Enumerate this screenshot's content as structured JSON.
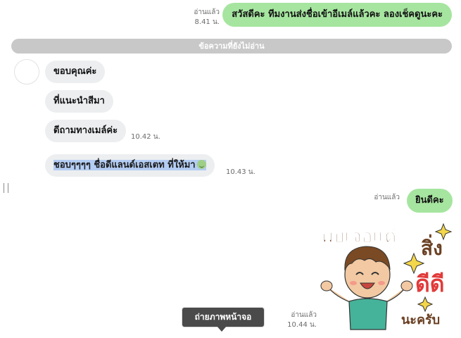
{
  "messages": {
    "m1": {
      "text": "สวัสดีคะ ทีมงานส่งชื่อเข้าอีเมล์แล้วคะ ลองเช็คดูนะคะ",
      "read": "อ่านแล้ว",
      "time": "8.41 น."
    },
    "unread_divider": "ข้อความที่ยังไม่อ่าน",
    "m2": {
      "text": "ขอบคุณค่ะ"
    },
    "m3": {
      "text": "ที่แนะนำสีมา"
    },
    "m4": {
      "text": "ดีถามทางเมล์ค่ะ",
      "time": "10.42 น."
    },
    "m5": {
      "text": "ชอบๆๆๆๆ ชื่อดีแลนด์เอสเตท ที่ให้มา",
      "time": "10.43 น."
    },
    "m6": {
      "text": "ยินดีคะ",
      "read": "อ่านแล้ว"
    },
    "sticker": {
      "line1": "พบเจอแต่",
      "line2": "สิ่ง",
      "line3": "ดีดี",
      "line4": "นะครับ",
      "read": "อ่านแล้ว",
      "time": "10.44 น."
    }
  },
  "tooltip": {
    "label": "ถ่ายภาพหน้าจอ"
  },
  "colors": {
    "outgoing_bubble": "#a6e5a0",
    "incoming_bubble": "#eceef0",
    "selection_highlight": "#b4cdf3",
    "unread_bar": "#c8c8c8"
  },
  "icons": [
    "smile-emoji-icon",
    "drag-handle-icon",
    "boy-sticker"
  ]
}
